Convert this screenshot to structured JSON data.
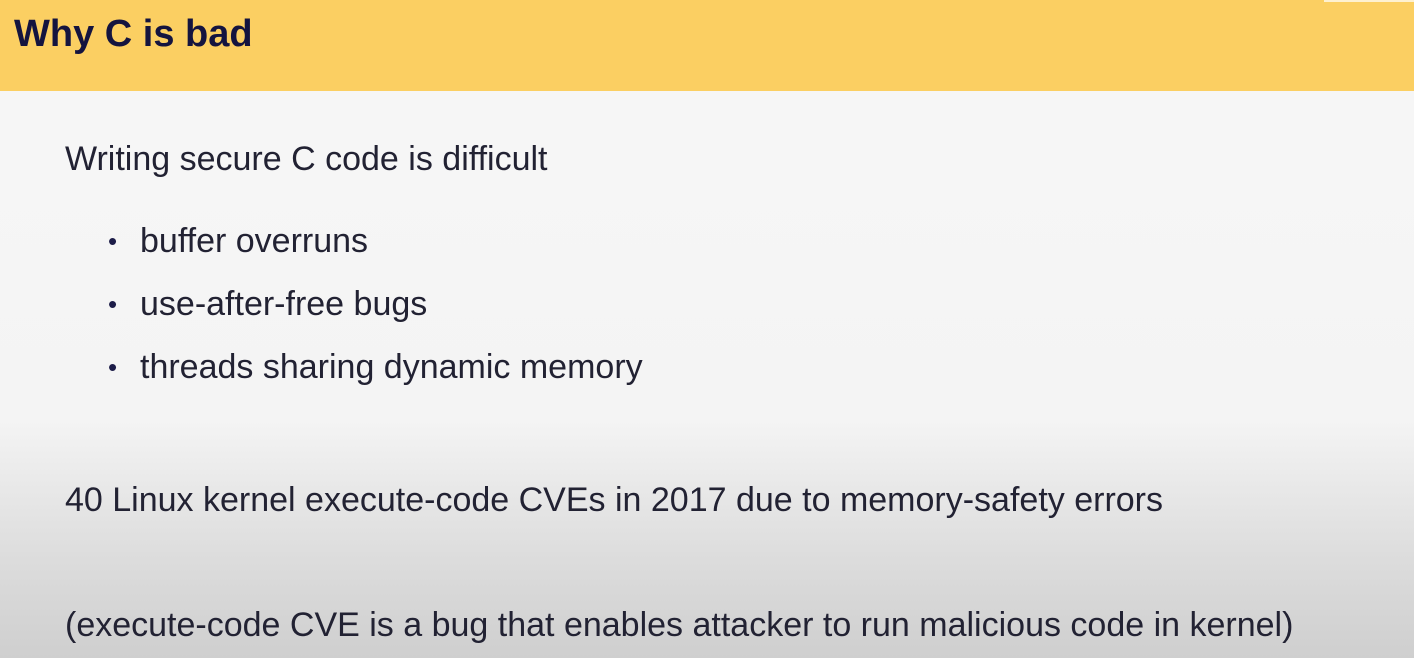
{
  "slide": {
    "title": "Why C is bad",
    "lead": "Writing secure C code is difficult",
    "bullets": [
      {
        "marker": "•",
        "label": "buffer overruns"
      },
      {
        "marker": "•",
        "label": "use-after-free bugs"
      },
      {
        "marker": "•",
        "label": "threads sharing dynamic memory"
      }
    ],
    "stat": "40 Linux kernel execute-code CVEs in 2017 due to memory-safety errors",
    "footnote": "(execute-code CVE is a bug that enables attacker to run malicious code in kernel)"
  },
  "colors": {
    "title_bar": "#fbcf62",
    "title_text": "#14143f",
    "body_text": "#222233",
    "background": "#f4f4f4"
  }
}
